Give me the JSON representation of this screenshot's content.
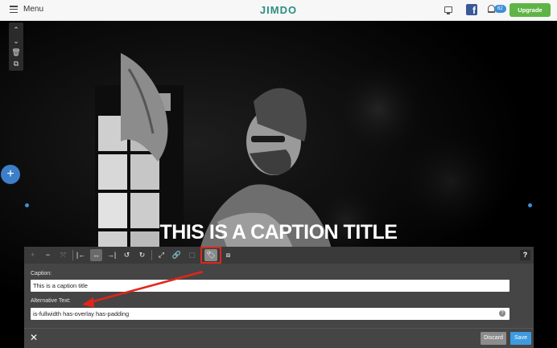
{
  "topbar": {
    "menu_label": "Menu",
    "logo": "JIMDO",
    "notification_count": "62",
    "upgrade_label": "Upgrade",
    "facebook_glyph": "f"
  },
  "side_tools": {
    "up_glyph": "⌃",
    "down_glyph": "⌄",
    "delete_glyph": "🗑",
    "copy_glyph": "⧉",
    "add_glyph": "+"
  },
  "hero": {
    "caption_title": "THIS IS A CAPTION TITLE"
  },
  "toolbar": {
    "glyphs": {
      "add": "+",
      "remove": "−",
      "fit": "⤧",
      "align_left": "|←",
      "align_center": "↔",
      "align_right": "→|",
      "undo": "↺",
      "redo": "↻",
      "expand": "⤢",
      "link": "🔗",
      "crop": "▢",
      "tag": "🏷",
      "caption": "⧈",
      "help": "?"
    }
  },
  "editor": {
    "caption_label": "Caption:",
    "caption_value": "This is a caption title",
    "alt_label": "Alternative Text:",
    "alt_value": "is-fullwidth has-overlay has-padding",
    "help_glyph": "?"
  },
  "footer": {
    "close_glyph": "✕",
    "discard_label": "Discard",
    "save_label": "Save"
  },
  "colors": {
    "brand": "#2a8f83",
    "upgrade": "#5eb446",
    "save": "#3d9be0",
    "highlight": "#e0261a"
  }
}
